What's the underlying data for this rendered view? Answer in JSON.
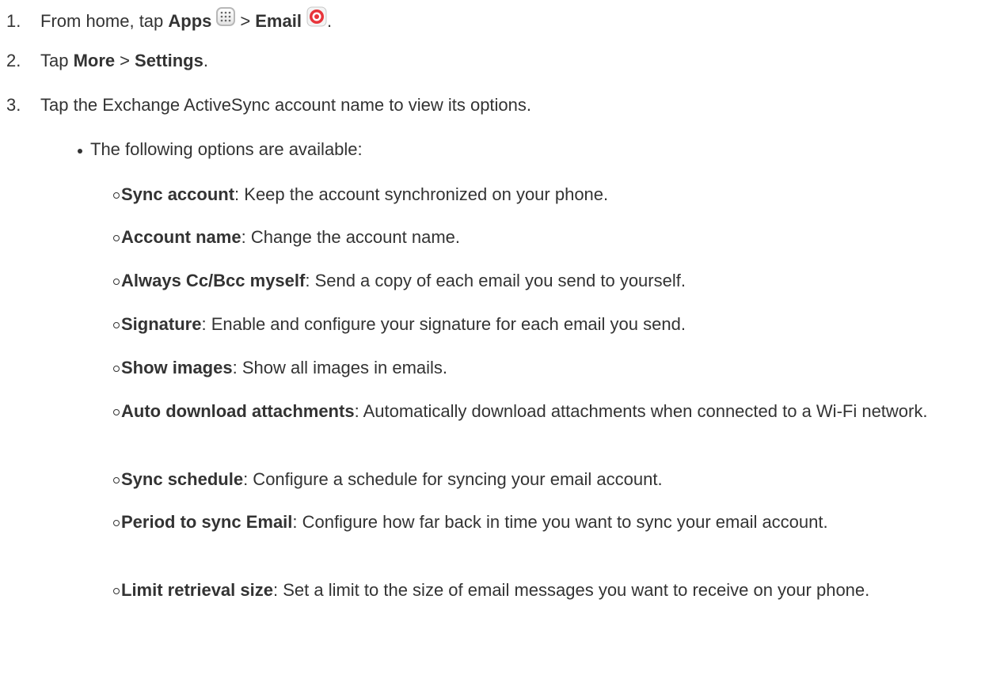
{
  "steps": [
    {
      "num": "1.",
      "prefix": "From home, tap ",
      "bold1": "Apps",
      "sep": ">",
      "bold2": "Email",
      "suffix": ".",
      "icon1": "apps-grid-icon",
      "icon2": "email-app-icon"
    },
    {
      "num": "2.",
      "prefix": "Tap ",
      "bold1": "More",
      "sep": ">",
      "bold2": "Settings",
      "suffix": "."
    },
    {
      "num": "3.",
      "text": "Tap the Exchange ActiveSync account name to view its options."
    }
  ],
  "bullet": "The following options are available:",
  "options": [
    {
      "term": "Sync account",
      "desc": ": Keep the account synchronized on your phone."
    },
    {
      "term": "Account name",
      "desc": ": Change the account name."
    },
    {
      "term": "Always Cc/Bcc myself",
      "desc": ": Send a copy of each email you send to yourself."
    },
    {
      "term": "Signature",
      "desc": ": Enable and configure your signature for each email you send."
    },
    {
      "term": "Show images",
      "desc": ": Show all images in emails."
    },
    {
      "term": "Auto download attachments",
      "desc": ": Automatically download attachments when connected to a Wi-Fi network."
    },
    {
      "term": "Sync schedule",
      "desc": ": Configure a schedule for syncing your email account."
    },
    {
      "term": "Period to sync Email",
      "desc": ": Configure how far back in time you want to sync your email account."
    },
    {
      "term": "Limit retrieval size",
      "desc": ": Set a limit to the size of email messages you want to receive on your phone."
    }
  ],
  "colors": {
    "text": "#333333",
    "email_icon_red": "#e8343a"
  }
}
